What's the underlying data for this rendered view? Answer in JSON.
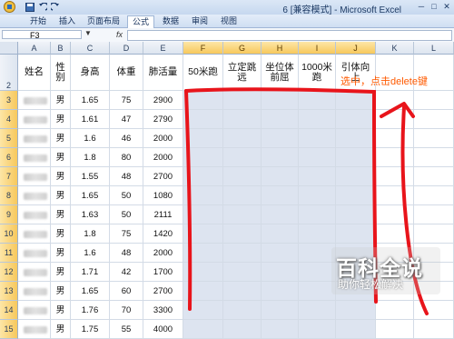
{
  "window": {
    "title": "6 [兼容模式] - Microsoft Excel",
    "quick_access": [
      "save-icon",
      "undo-icon",
      "redo-icon"
    ]
  },
  "ribbon": {
    "tabs": [
      "开始",
      "插入",
      "页面布局",
      "公式",
      "数据",
      "审阅",
      "视图"
    ],
    "active_tab": "公式"
  },
  "formula_bar": {
    "name_box": "F3",
    "fx": "fx",
    "content": ""
  },
  "sheet": {
    "columns": [
      "A",
      "B",
      "C",
      "D",
      "E",
      "F",
      "G",
      "H",
      "I",
      "J",
      "K",
      "L"
    ],
    "rows": [
      "2",
      "3",
      "4",
      "5",
      "6",
      "7",
      "8",
      "9",
      "10",
      "11",
      "12",
      "13",
      "14",
      "15"
    ],
    "headers": [
      "姓名",
      "性别",
      "身高",
      "体重",
      "肺活量",
      "50米跑",
      "立定跳远",
      "坐位体前屈",
      "1000米跑",
      "引体向上",
      "",
      ""
    ],
    "data": [
      [
        "",
        "男",
        "1.65",
        "75",
        "2900"
      ],
      [
        "",
        "男",
        "1.61",
        "47",
        "2790"
      ],
      [
        "",
        "男",
        "1.6",
        "46",
        "2000"
      ],
      [
        "",
        "男",
        "1.8",
        "80",
        "2000"
      ],
      [
        "",
        "男",
        "1.55",
        "48",
        "2700"
      ],
      [
        "",
        "男",
        "1.65",
        "50",
        "1080"
      ],
      [
        "",
        "男",
        "1.63",
        "50",
        "2111"
      ],
      [
        "",
        "男",
        "1.8",
        "75",
        "1420"
      ],
      [
        "",
        "男",
        "1.6",
        "48",
        "2000"
      ],
      [
        "",
        "男",
        "1.71",
        "42",
        "1700"
      ],
      [
        "",
        "男",
        "1.65",
        "60",
        "2700"
      ],
      [
        "",
        "男",
        "1.76",
        "70",
        "3300"
      ],
      [
        "",
        "男",
        "1.75",
        "55",
        "4000"
      ]
    ]
  },
  "annotation": "选中，点击delete键",
  "watermark": {
    "title": "百科全说",
    "subtitle": "助你轻松解决"
  },
  "colors": {
    "ink": "#e8141b",
    "annotation": "#ff5a00",
    "selection": "#dde4f0"
  }
}
